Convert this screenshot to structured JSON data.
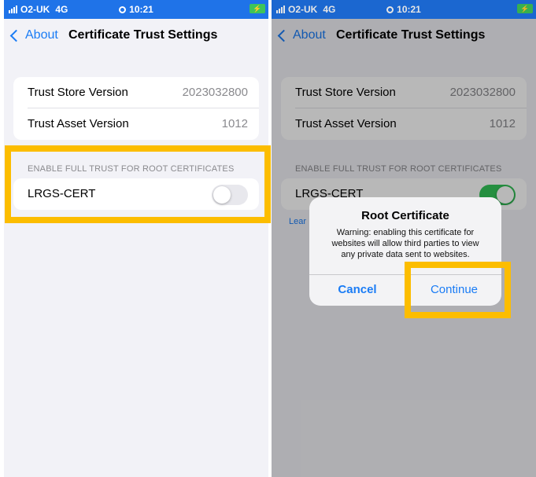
{
  "colors": {
    "accent": "#1a7cf5",
    "highlight": "#fcbd00",
    "statusbar": "#1f73e8",
    "toggle_on": "#34c759"
  },
  "status": {
    "carrier": "O2-UK",
    "network": "4G",
    "time": "10:21"
  },
  "nav": {
    "back_label": "About",
    "title": "Certificate Trust Settings"
  },
  "info": {
    "trust_store_label": "Trust Store Version",
    "trust_store_value": "2023032800",
    "trust_asset_label": "Trust Asset Version",
    "trust_asset_value": "1012"
  },
  "section_header": "ENABLE FULL TRUST FOR ROOT CERTIFICATES",
  "cert": {
    "name": "LRGS-CERT"
  },
  "learn_more": "Lear",
  "alert": {
    "title": "Root Certificate",
    "message_line1": "Warning: enabling this certificate for",
    "message_line2": "websites will allow third parties to view",
    "message_line3": "any private data sent to websites.",
    "cancel": "Cancel",
    "continue": "Continue"
  }
}
